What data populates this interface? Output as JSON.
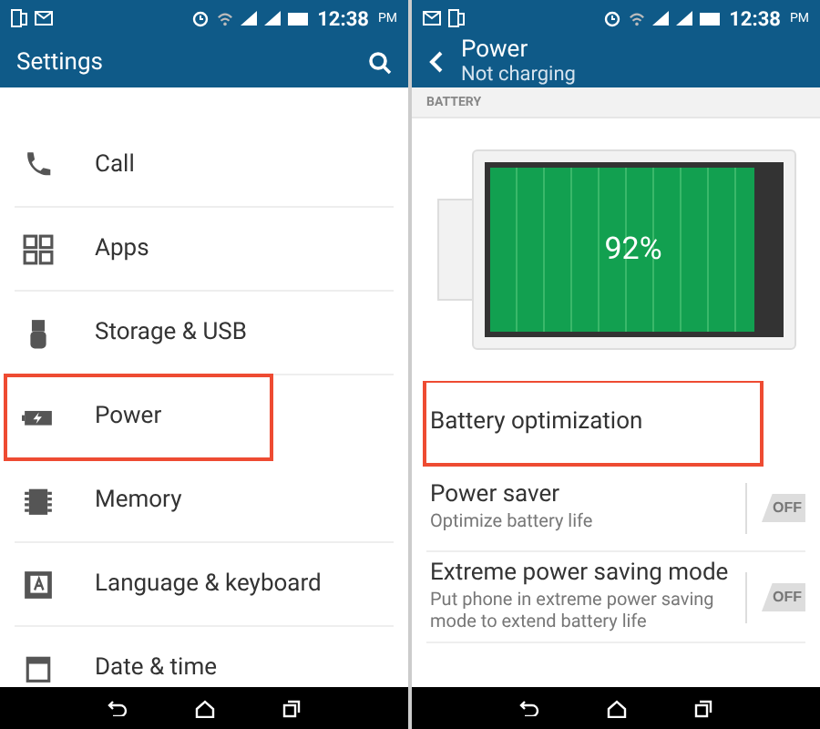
{
  "left_screen": {
    "status_bar": {
      "time": "12:38",
      "meridiem": "PM"
    },
    "app_bar": {
      "title": "Settings"
    },
    "items": [
      {
        "label": "Call",
        "highlighted": false
      },
      {
        "label": "Apps",
        "highlighted": false
      },
      {
        "label": "Storage & USB",
        "highlighted": false
      },
      {
        "label": "Power",
        "highlighted": true
      },
      {
        "label": "Memory",
        "highlighted": false
      },
      {
        "label": "Language & keyboard",
        "highlighted": false
      },
      {
        "label": "Date & time",
        "highlighted": false
      }
    ]
  },
  "right_screen": {
    "status_bar": {
      "time": "12:38",
      "meridiem": "PM"
    },
    "app_bar": {
      "title": "Power",
      "subtitle": "Not charging"
    },
    "section": "BATTERY",
    "battery": {
      "level": 0.92,
      "reading": "92%"
    },
    "rows": [
      {
        "kind": "link",
        "title": "Battery optimization",
        "highlighted": true
      },
      {
        "kind": "toggle",
        "title": "Power saver",
        "subtitle": "Optimize battery life",
        "on": false,
        "toggle_label": "OFF"
      },
      {
        "kind": "toggle",
        "title": "Extreme power saving mode",
        "subtitle": "Put phone in extreme power saving mode to extend battery life",
        "on": false,
        "toggle_label": "OFF"
      }
    ]
  }
}
